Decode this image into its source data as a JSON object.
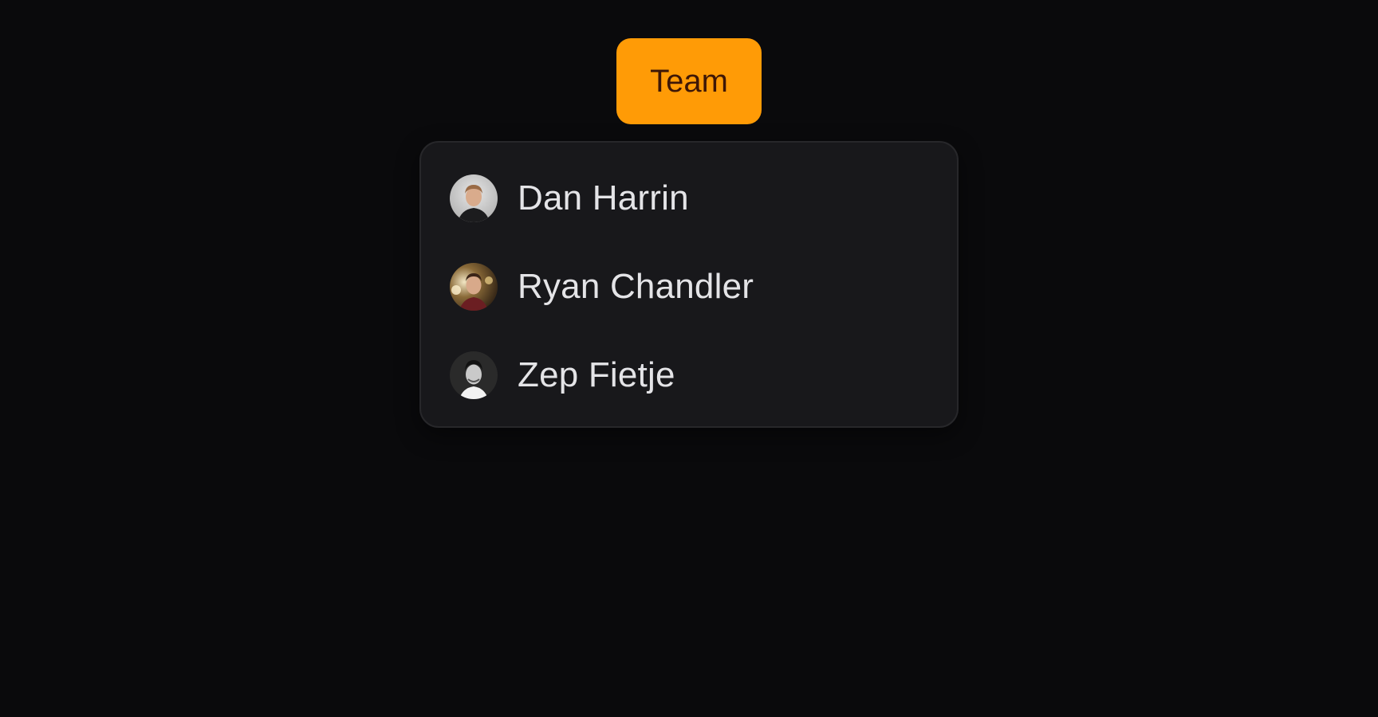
{
  "trigger": {
    "label": "Team",
    "color": "#ff9b06",
    "text_color": "#3e1706"
  },
  "menu": {
    "items": [
      {
        "name": "Dan Harrin",
        "avatar": "user-avatar-photo"
      },
      {
        "name": "Ryan Chandler",
        "avatar": "user-avatar-photo"
      },
      {
        "name": "Zep Fietje",
        "avatar": "user-avatar-photo"
      }
    ]
  },
  "colors": {
    "background": "#0a0a0c",
    "panel": "#18181b",
    "panel_border": "#27272a",
    "item_text": "#e4e4e7"
  }
}
